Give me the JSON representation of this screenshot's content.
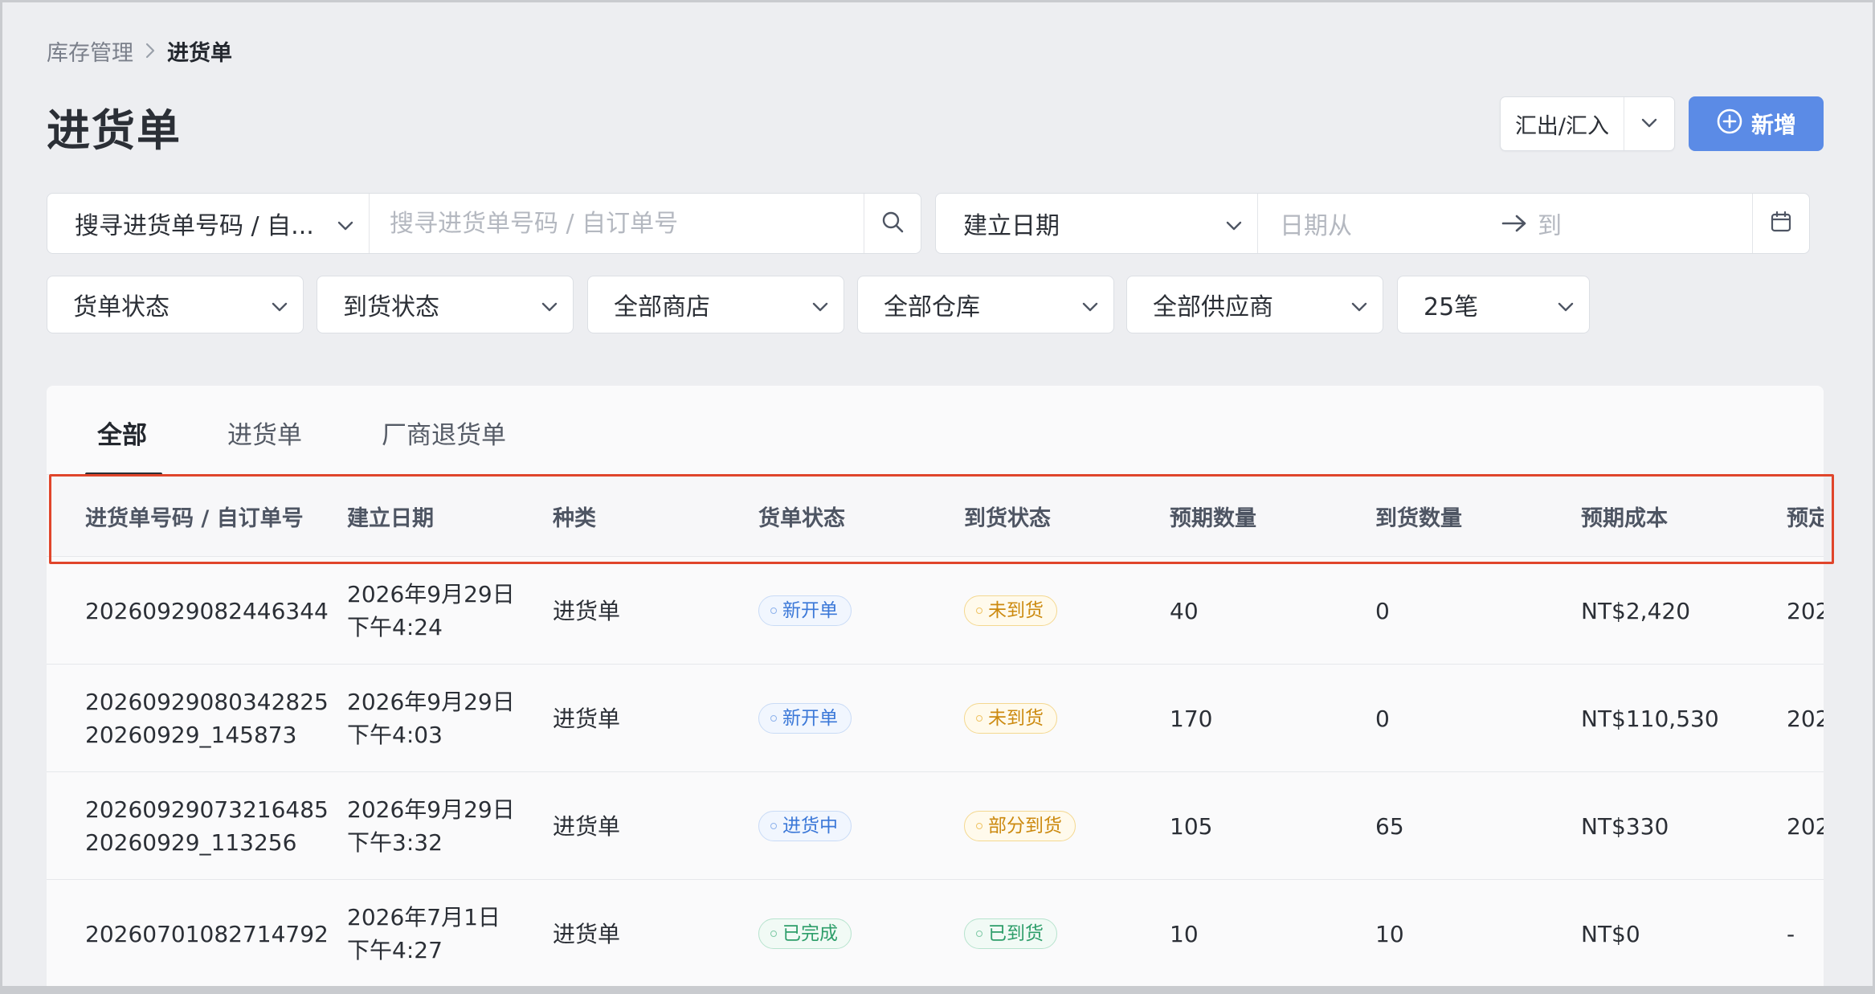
{
  "breadcrumb": {
    "parent": "库存管理",
    "current": "进货单"
  },
  "page_title": "进货单",
  "actions": {
    "export_import_label": "汇出/汇入",
    "add_label": "新增"
  },
  "search": {
    "type_label": "搜寻进货单号码 / 自...",
    "placeholder": "搜寻进货单号码 / 自订单号"
  },
  "date_filter": {
    "type_label": "建立日期",
    "from_placeholder": "日期从",
    "to_placeholder": "到"
  },
  "filters": [
    {
      "label": "货单状态"
    },
    {
      "label": "到货状态"
    },
    {
      "label": "全部商店"
    },
    {
      "label": "全部仓库"
    },
    {
      "label": "全部供应商"
    },
    {
      "label": "25笔"
    }
  ],
  "tabs": [
    {
      "label": "全部",
      "active": true
    },
    {
      "label": "进货单",
      "active": false
    },
    {
      "label": "厂商退货单",
      "active": false
    }
  ],
  "table": {
    "headers": [
      "进货单号码 / 自订单号",
      "建立日期",
      "种类",
      "货单状态",
      "到货状态",
      "预期数量",
      "到货数量",
      "预期成本",
      "预定"
    ],
    "rows": [
      {
        "number": "20260929082446344",
        "custom_no": "",
        "date": "2026年9月29日",
        "time": "下午4:24",
        "kind": "进货单",
        "order_status": "新开单",
        "order_status_color": "#3b78d8",
        "arrival_status": "未到货",
        "arrival_status_color": "#cc8a10",
        "expected_qty": "40",
        "received_qty": "0",
        "expected_cost": "NT$2,420",
        "scheduled": "202"
      },
      {
        "number": "20260929080342825",
        "custom_no": "20260929_145873",
        "date": "2026年9月29日",
        "time": "下午4:03",
        "kind": "进货单",
        "order_status": "新开单",
        "order_status_color": "#3b78d8",
        "arrival_status": "未到货",
        "arrival_status_color": "#cc8a10",
        "expected_qty": "170",
        "received_qty": "0",
        "expected_cost": "NT$110,530",
        "scheduled": "202"
      },
      {
        "number": "20260929073216485",
        "custom_no": "20260929_113256",
        "date": "2026年9月29日",
        "time": "下午3:32",
        "kind": "进货单",
        "order_status": "进货中",
        "order_status_color": "#3b78d8",
        "arrival_status": "部分到货",
        "arrival_status_color": "#cc8a10",
        "expected_qty": "105",
        "received_qty": "65",
        "expected_cost": "NT$330",
        "scheduled": "202"
      },
      {
        "number": "20260701082714792",
        "custom_no": "",
        "date": "2026年7月1日",
        "time": "下午4:27",
        "kind": "进货单",
        "order_status": "已完成",
        "order_status_color": "#2e9e6a",
        "arrival_status": "已到货",
        "arrival_status_color": "#2e9e6a",
        "expected_qty": "10",
        "received_qty": "10",
        "expected_cost": "NT$0",
        "scheduled": "-"
      }
    ]
  },
  "colors": {
    "primary": "#5b8be6",
    "highlight_border": "#e0452b"
  }
}
